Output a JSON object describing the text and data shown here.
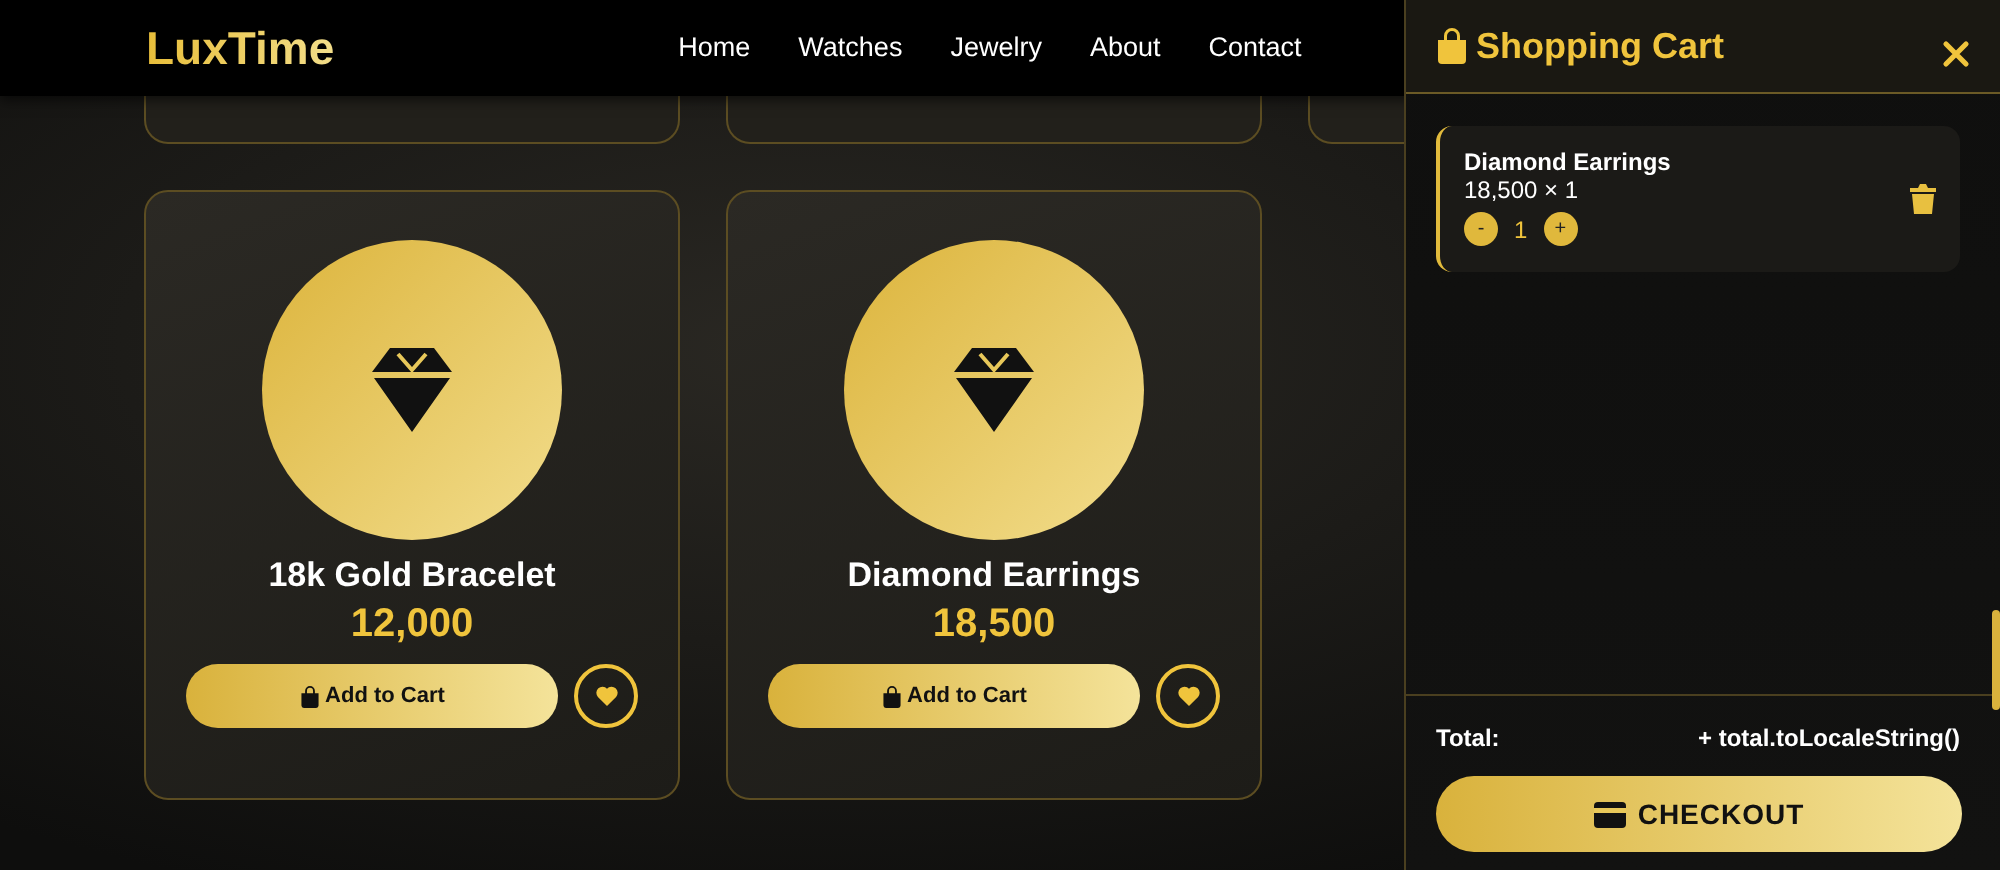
{
  "navbar": {
    "brand": "LuxTime",
    "links": [
      "Home",
      "Watches",
      "Jewelry",
      "About",
      "Contact"
    ]
  },
  "products": [
    {
      "name": "18k Gold Bracelet",
      "price": "12,000",
      "button": "Add to Cart"
    },
    {
      "name": "Diamond Earrings",
      "price": "18,500",
      "button": "Add to Cart"
    }
  ],
  "cart": {
    "title": "Shopping Cart",
    "items": [
      {
        "name": "Diamond Earrings",
        "line": "18,500 × 1",
        "quantity": "1",
        "minus": "-",
        "plus": "+"
      }
    ],
    "total_label": "Total:",
    "total_value": "+ total.toLocaleString()",
    "checkout": "CHECKOUT"
  }
}
